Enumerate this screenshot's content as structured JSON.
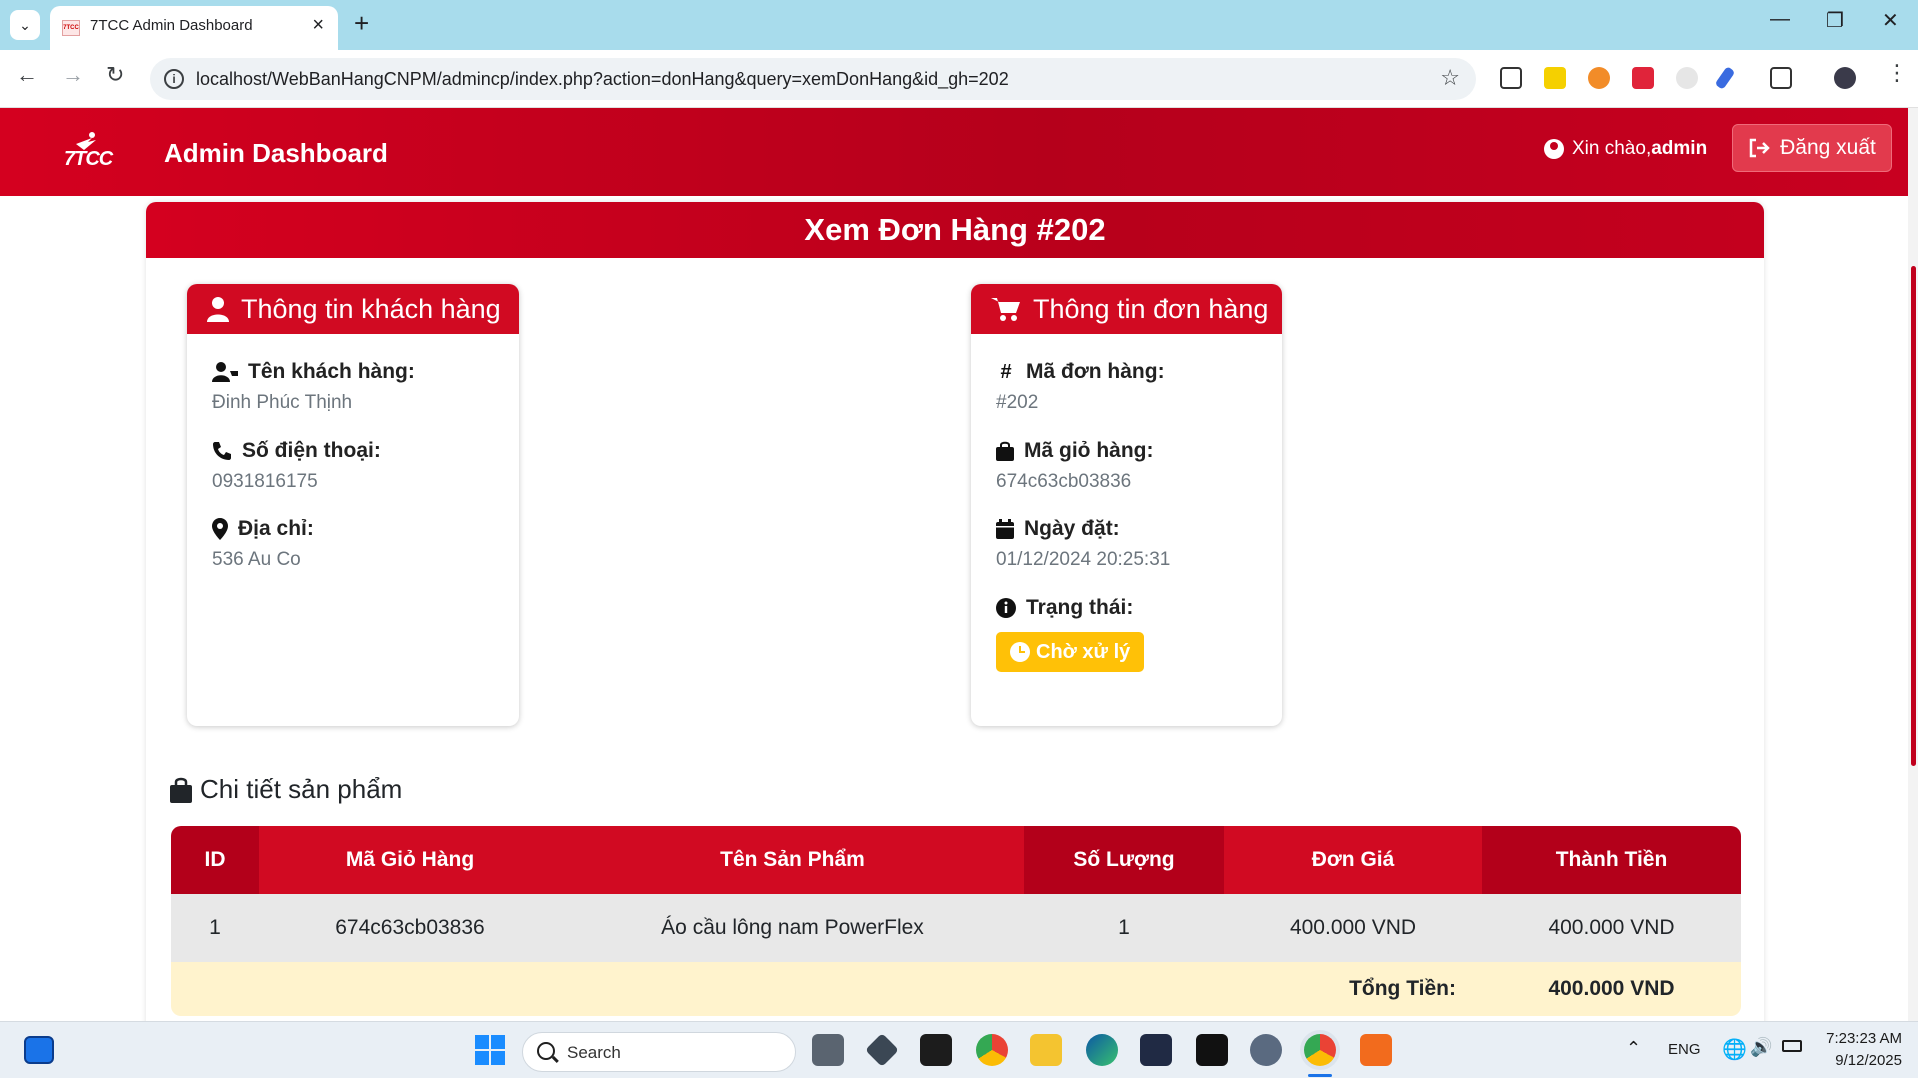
{
  "browser": {
    "tab_title": "7TCC Admin Dashboard",
    "favicon_text": "7TCC",
    "url": "localhost/WebBanHangCNPM/admincp/index.php?action=donHang&query=xemDonHang&id_gh=202"
  },
  "header": {
    "logo_text": "7TCC",
    "brand": "Admin Dashboard",
    "greeting": "Xin chào,",
    "username": "admin",
    "logout_label": "Đăng xuất"
  },
  "page": {
    "title": "Xem Đơn Hàng #202"
  },
  "customer": {
    "heading": "Thông tin khách hàng",
    "name_label": "Tên khách hàng:",
    "name": "Đinh Phúc Thịnh",
    "phone_label": "Số điện thoại:",
    "phone": "0931816175",
    "address_label": "Địa chỉ:",
    "address": "536 Au Co"
  },
  "order": {
    "heading": "Thông tin đơn hàng",
    "id_label": "Mã đơn hàng:",
    "id": "#202",
    "cart_label": "Mã giỏ hàng:",
    "cart_code": "674c63cb03836",
    "date_label": "Ngày đặt:",
    "date": "01/12/2024 20:25:31",
    "status_label": "Trạng thái:",
    "status": "Chờ xử lý",
    "status_color": "#ffc107"
  },
  "products": {
    "section_title": "Chi tiết sản phẩm",
    "columns": [
      "ID",
      "Mã Giỏ Hàng",
      "Tên Sản Phẩm",
      "Số Lượng",
      "Đơn Giá",
      "Thành Tiền"
    ],
    "rows": [
      [
        "1",
        "674c63cb03836",
        "Áo cầu lông nam PowerFlex",
        "1",
        "400.000 VND",
        "400.000 VND"
      ]
    ],
    "total_label": "Tổng Tiền:",
    "total_value": "400.000 VND"
  },
  "taskbar": {
    "search_placeholder": "Search",
    "language": "ENG",
    "time": "7:23:23 AM",
    "date": "9/12/2025"
  },
  "colors": {
    "primary": "#d10a22",
    "primary_dark": "#b3001a",
    "badge_warning": "#ffc107",
    "total_row": "#fff3cd"
  }
}
